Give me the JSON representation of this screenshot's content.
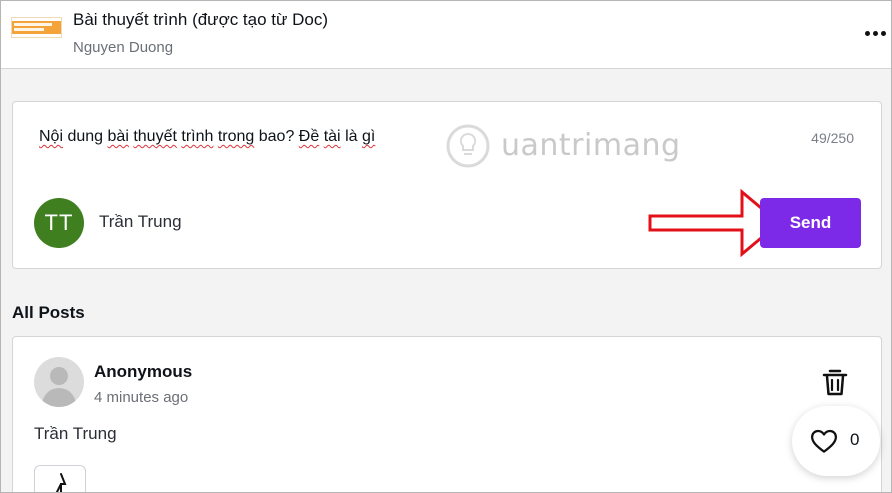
{
  "header": {
    "title": "Bài thuyết trình (được tạo từ Doc)",
    "owner": "Nguyen Duong",
    "more_icon": "more-horizontal-icon"
  },
  "composer": {
    "text_parts": [
      "Nội",
      " ",
      "dung",
      " ",
      "bài",
      " ",
      "thuyết",
      " ",
      "trình",
      " ",
      "trong",
      " bao? ",
      "Đề",
      " ",
      "tài",
      " ",
      "là",
      " ",
      "gì"
    ],
    "counter": "49/250",
    "avatar_initials": "TT",
    "avatar_color": "#3f7f1f",
    "user_name": "Trần Trung",
    "send_label": "Send",
    "send_color": "#7d2ae8",
    "watermark": "uantrimang"
  },
  "posts": {
    "section_title": "All Posts",
    "items": [
      {
        "author": "Anonymous",
        "time": "4 minutes ago",
        "body": "Trần Trung",
        "likes": "0"
      }
    ]
  },
  "colors": {
    "accent": "#7d2ae8",
    "annotation_arrow": "#e3101a"
  }
}
